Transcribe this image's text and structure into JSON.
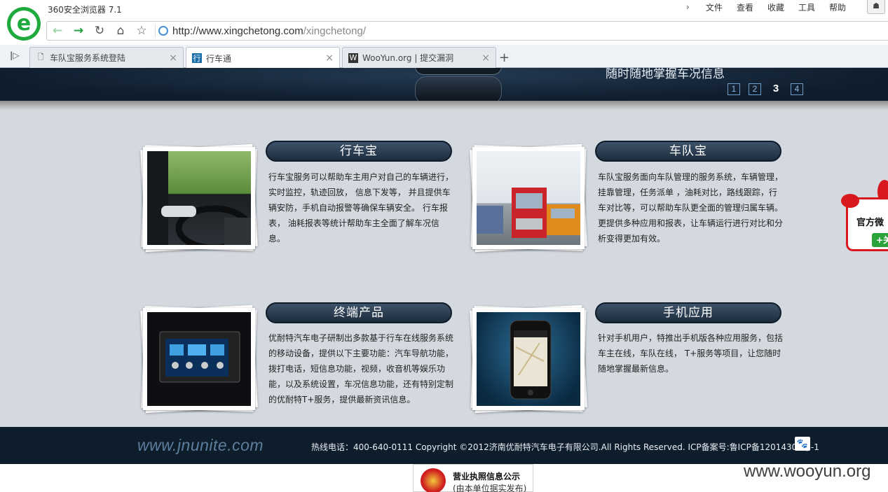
{
  "browser": {
    "app_title": "360安全浏览器 7.1",
    "menu": [
      "文件",
      "查看",
      "收藏",
      "工具",
      "帮助"
    ],
    "url_host": "http://www.xingchetong.com",
    "url_path": "/xingchetong/",
    "tabs": [
      {
        "label": "车队宝服务系统登陆",
        "icon": "document-icon"
      },
      {
        "label": "行车通",
        "icon": "site-favicon"
      },
      {
        "label": "WooYun.org | 提交漏洞",
        "icon": "wooyun-favicon"
      }
    ]
  },
  "banner": {
    "slogan": "随时随地掌握车况信息",
    "pages": [
      "1",
      "2",
      "3",
      "4"
    ],
    "current_page": "3"
  },
  "cards": [
    {
      "title": "行车宝",
      "description": "行车宝服务可以帮助车主用户对自己的车辆进行，实时监控，轨迹回放， 信息下发等， 并且提供车辆安防，手机自动报警等确保车辆安全。 行车报表， 油耗报表等统计帮助车主全面了解车况信息。"
    },
    {
      "title": "车队宝",
      "description": "车队宝服务面向车队管理的服务系统，车辆管理，挂靠管理，任务派单 ，油耗对比，路线跟踪，行车对比等，可以帮助车队更全面的管理归属车辆。更提供多种应用和报表，让车辆运行进行对比和分析变得更加有效。"
    },
    {
      "title": "终端产品",
      "description": "优耐特汽车电子研制出多款基于行车在线服务系统的移动设备，提供以下主要功能：汽车导航功能，拨打电话，短信息功能，视频，收音机等娱乐功能，以及系统设置，车况信息功能，还有特别定制的优耐特T+服务，提供最新资讯信息。"
    },
    {
      "title": "手机应用",
      "description": "针对手机用户，特推出手机版各种应用服务，包括车主在线，车队在线， T+服务等项目，让您随时随地掌握最新信息。"
    }
  ],
  "footer": {
    "logo_text": "www.jnunite.com",
    "info": "热线电话：400-640-0111 Copyright ©2012济南优耐特汽车电子有限公司.All Rights Reserved. ICP备案号:鲁ICP备12014305号-1"
  },
  "license_badge": {
    "line1": "营业执照信息公示",
    "line2": "(由本单位据实发布)"
  },
  "weibo": {
    "label": "官方微",
    "follow": "+关"
  },
  "watermark": "www.wooyun.org"
}
